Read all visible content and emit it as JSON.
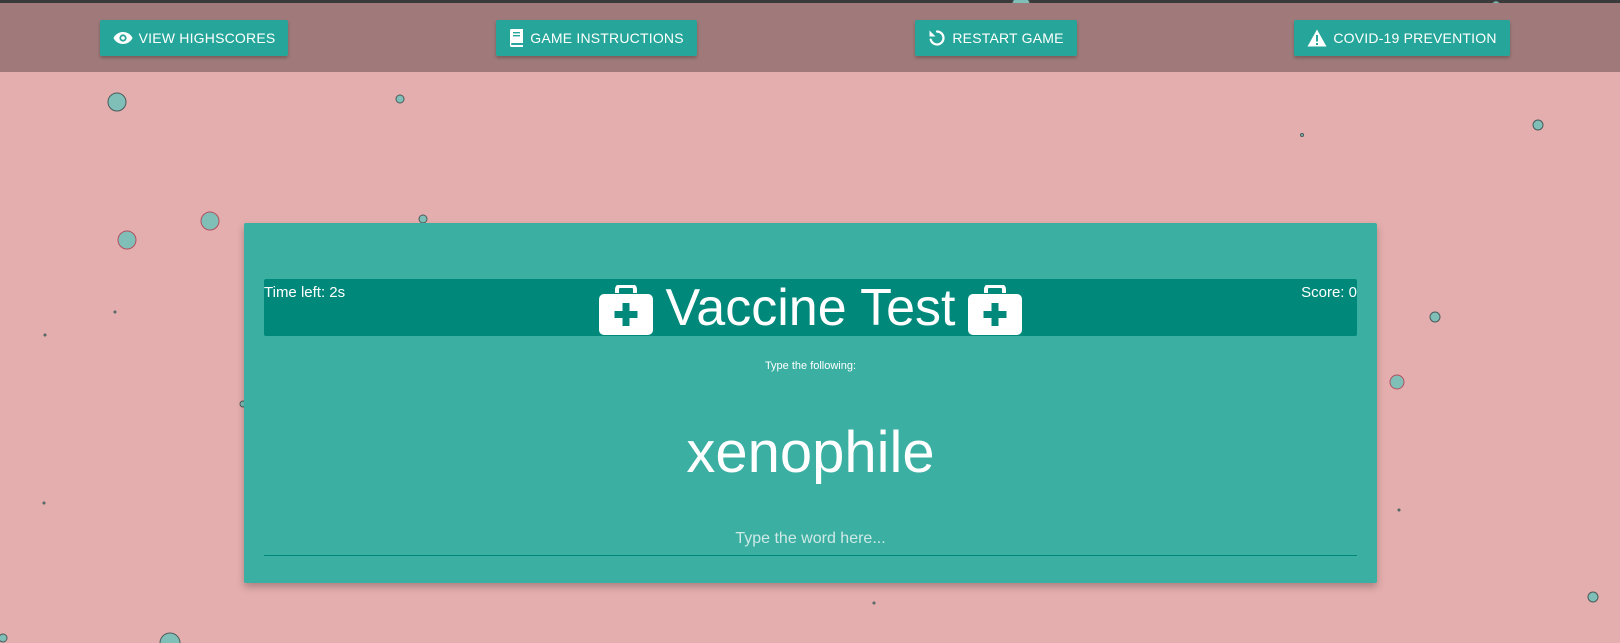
{
  "nav": {
    "highscores_label": "VIEW HIGHSCORES",
    "instructions_label": "GAME INSTRUCTIONS",
    "restart_label": "RESTART GAME",
    "covid_label": "COVID-19 PREVENTION"
  },
  "game": {
    "time_left": "Time left: 2s",
    "score": "Score: 0",
    "title": "Vaccine Test",
    "prompt": "Type the following:",
    "word": "xenophile",
    "input_placeholder": "Type the word here...",
    "input_value": ""
  },
  "icons": {
    "highscores": "eye-icon",
    "instructions": "book-icon",
    "restart": "restart-icon",
    "covid": "warning-icon",
    "title_left": "medical-kit-icon",
    "title_right": "medical-kit-icon"
  },
  "colors": {
    "background": "#e5aeae",
    "navbar": "#a07a7a",
    "button": "#26a69a",
    "card": "#3aafa2",
    "header_bar": "#00897b",
    "bubble_fill": "#7fbfb8"
  }
}
